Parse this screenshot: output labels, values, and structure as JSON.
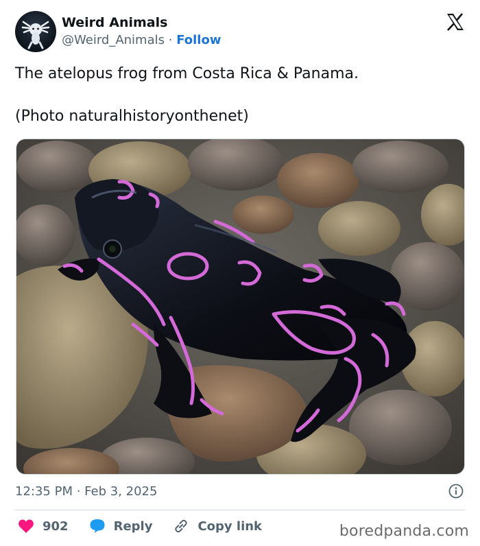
{
  "author": {
    "display_name": "Weird Animals",
    "handle": "@Weird_Animals",
    "separator": "·",
    "follow_label": "Follow",
    "avatar_icon": "axolotl-avatar"
  },
  "platform_icon": "x-logo-icon",
  "tweet": {
    "line1": "The atelopus frog from Costa Rica & Panama.",
    "line2": "(Photo naturalhistoryonthenet)"
  },
  "media": {
    "subject": "black frog with pink markings on rocks"
  },
  "meta": {
    "timestamp": "12:35 PM · Feb 3, 2025"
  },
  "actions": {
    "like_count": "902",
    "reply_label": "Reply",
    "copy_label": "Copy link"
  },
  "watermark": "boredpanda.com",
  "colors": {
    "like": "#f91880",
    "reply": "#1d9bf0",
    "follow": "#1d74d3",
    "muted": "#536471"
  }
}
